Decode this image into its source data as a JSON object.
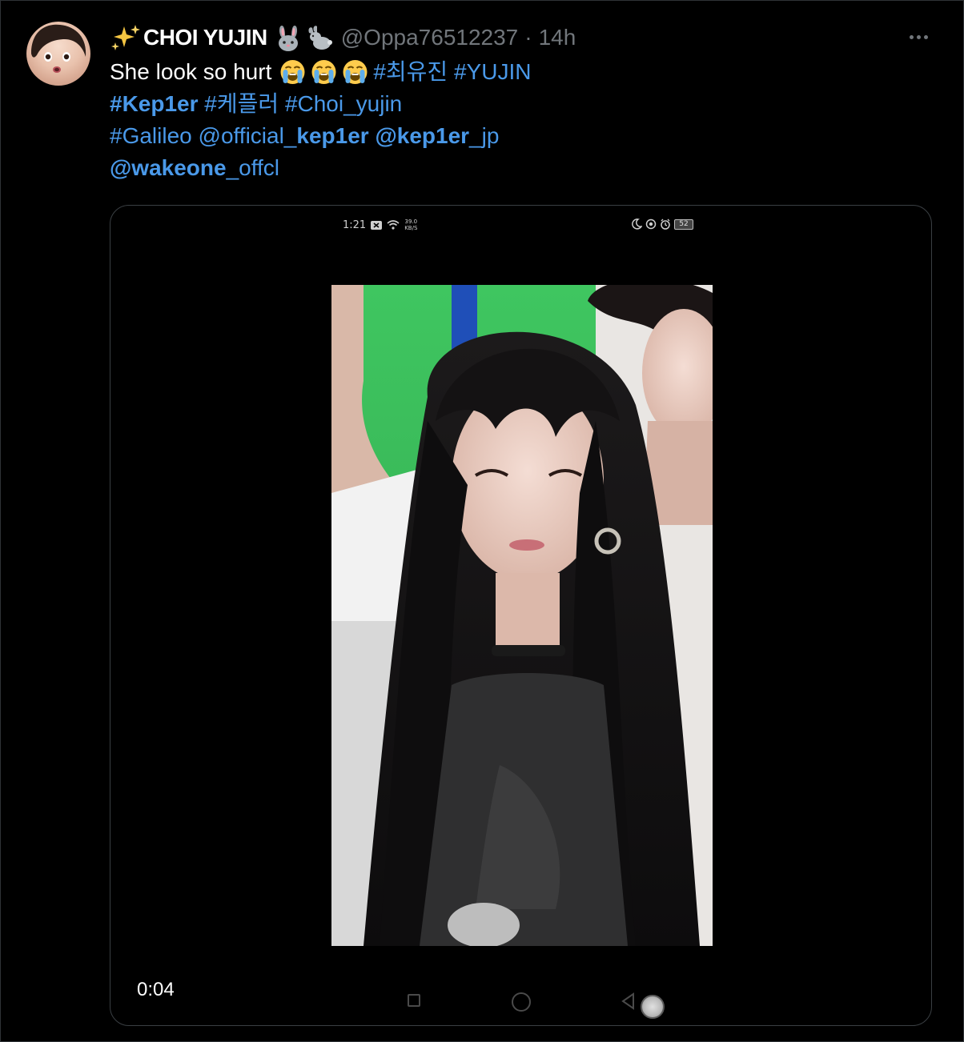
{
  "tweet": {
    "display_name": "CHOI YUJIN",
    "leading_emoji": "sparkles-icon",
    "trailing_emojis": [
      "rabbit-face-icon",
      "rabbit-icon"
    ],
    "handle": "@Oppa76512237",
    "separator": "·",
    "time": "14h",
    "more_label": "···",
    "text": {
      "line1_plain": "She look so hurt",
      "line1_emojis": [
        "loudly-crying-face-icon",
        "loudly-crying-face-icon",
        "loudly-crying-face-icon"
      ],
      "line1_tags": [
        "#최유진",
        "#YUJIN"
      ],
      "line2": [
        "#",
        "Kep1er",
        "#케플러",
        "#Choi_yujin"
      ],
      "line3": [
        "#Galileo",
        "@official_",
        "kep1er",
        "@kep1er",
        "_jp"
      ],
      "line4": [
        "@wakeone",
        "_offcl"
      ]
    }
  },
  "media": {
    "status_bar": {
      "time": "1:21",
      "net_speed_value": "39.0",
      "net_speed_unit": "KB/S",
      "battery": "52"
    },
    "video_time": "0:04"
  },
  "colors": {
    "background": "#000000",
    "text": "#ffffff",
    "muted": "#71767b",
    "link": "#4a99e9",
    "card_border": "#3a3f43"
  }
}
